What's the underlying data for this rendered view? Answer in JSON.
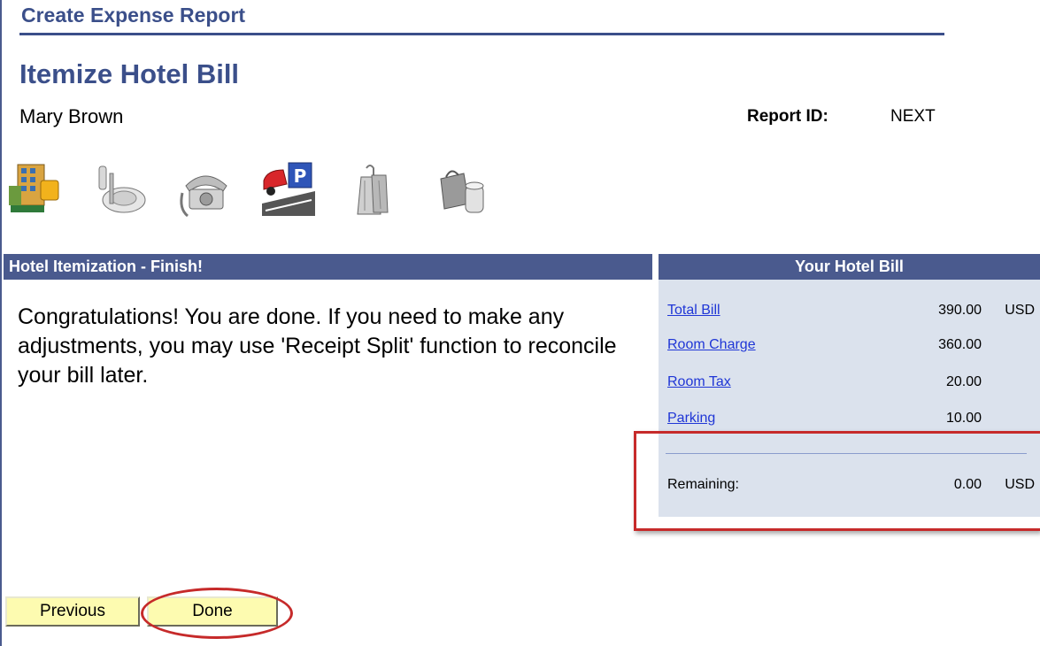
{
  "header": {
    "app_title": "Create Expense Report",
    "page_title": "Itemize Hotel Bill",
    "employee_name": "Mary Brown",
    "report_id_label": "Report ID:",
    "report_id_value": "NEXT"
  },
  "icons": [
    "hotel-icon",
    "meals-icon",
    "phone-icon",
    "parking-icon",
    "laundry-icon",
    "misc-icon"
  ],
  "itemization": {
    "header": "Hotel Itemization - Finish!",
    "message": "Congratulations! You are done. If you need to make any adjustments, you may use 'Receipt Split' function to reconcile your bill later."
  },
  "bill": {
    "header": "Your Hotel Bill",
    "rows": [
      {
        "label": "Total Bill",
        "amount": "390.00",
        "currency": "USD"
      },
      {
        "label": "Room Charge",
        "amount": "360.00",
        "currency": ""
      },
      {
        "label": "Room Tax",
        "amount": "20.00",
        "currency": ""
      },
      {
        "label": "Parking",
        "amount": "10.00",
        "currency": ""
      }
    ],
    "remaining_label": "Remaining:",
    "remaining_amount": "0.00",
    "remaining_currency": "USD"
  },
  "buttons": {
    "previous": "Previous",
    "done": "Done"
  },
  "colors": {
    "brand": "#3b4f8a",
    "panel_header": "#4a5a8e",
    "panel_bg": "#dbe2ed",
    "button_bg": "#fdfbb0",
    "highlight": "#c62a2a",
    "link": "#1f36d6"
  }
}
